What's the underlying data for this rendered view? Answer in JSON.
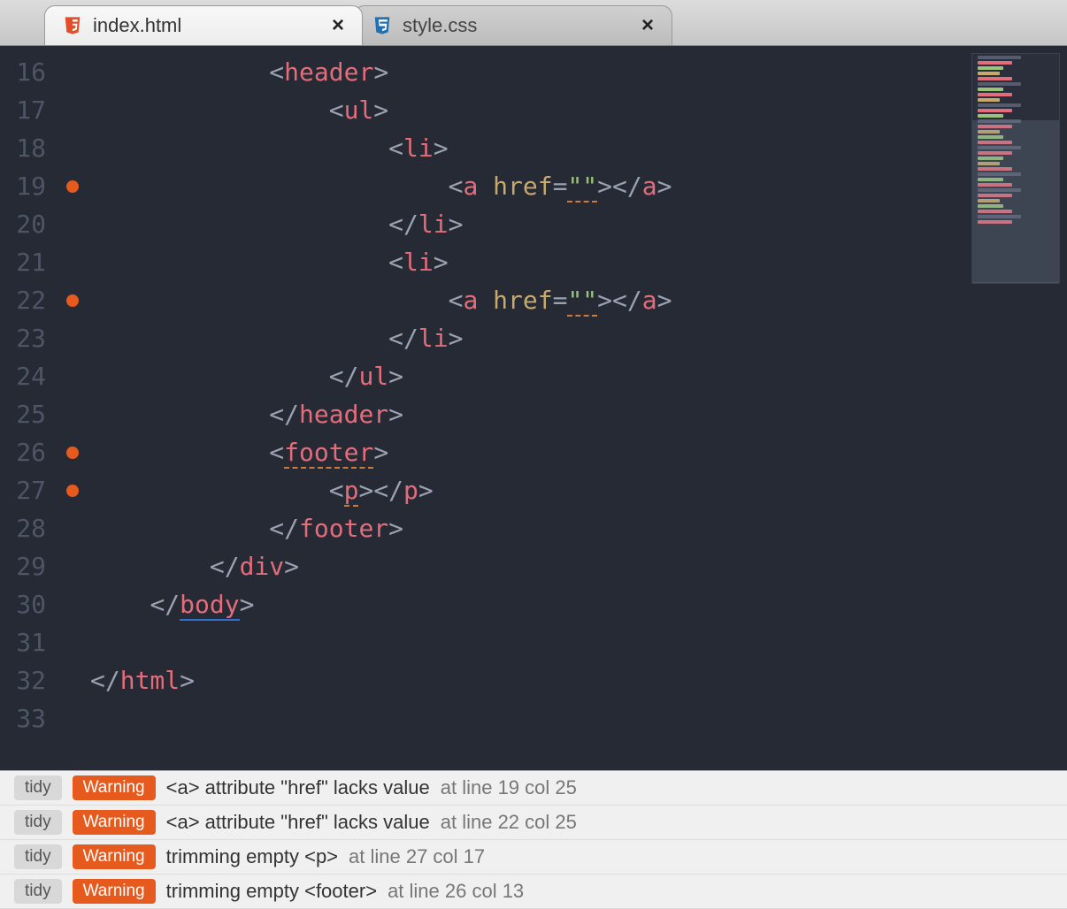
{
  "tabs": [
    {
      "title": "index.html",
      "icon": "html5",
      "active": true
    },
    {
      "title": "style.css",
      "icon": "css3",
      "active": false
    }
  ],
  "editor": {
    "first_line": 16,
    "last_line": 33,
    "error_marker_lines": [
      19,
      22,
      26,
      27
    ],
    "lines": {
      "16": {
        "indent": 12,
        "tokens": [
          [
            "br",
            "<"
          ],
          [
            "tg",
            "header"
          ],
          [
            "br",
            ">"
          ]
        ]
      },
      "17": {
        "indent": 16,
        "tokens": [
          [
            "br",
            "<"
          ],
          [
            "tg",
            "ul"
          ],
          [
            "br",
            ">"
          ]
        ]
      },
      "18": {
        "indent": 20,
        "tokens": [
          [
            "br",
            "<"
          ],
          [
            "tg",
            "li"
          ],
          [
            "br",
            ">"
          ]
        ]
      },
      "19": {
        "indent": 24,
        "tokens": [
          [
            "br",
            "<"
          ],
          [
            "tg",
            "a"
          ],
          [
            "br",
            " "
          ],
          [
            "at",
            "href"
          ],
          [
            "br",
            "="
          ],
          [
            "st",
            "\"\"",
            "ul1"
          ],
          [
            "br",
            "></"
          ],
          [
            "tg",
            "a"
          ],
          [
            "br",
            ">"
          ]
        ]
      },
      "20": {
        "indent": 20,
        "tokens": [
          [
            "br",
            "</"
          ],
          [
            "tg",
            "li"
          ],
          [
            "br",
            ">"
          ]
        ]
      },
      "21": {
        "indent": 20,
        "tokens": [
          [
            "br",
            "<"
          ],
          [
            "tg",
            "li"
          ],
          [
            "br",
            ">"
          ]
        ]
      },
      "22": {
        "indent": 24,
        "tokens": [
          [
            "br",
            "<"
          ],
          [
            "tg",
            "a"
          ],
          [
            "br",
            " "
          ],
          [
            "at",
            "href"
          ],
          [
            "br",
            "="
          ],
          [
            "st",
            "\"\"",
            "ul1"
          ],
          [
            "br",
            "></"
          ],
          [
            "tg",
            "a"
          ],
          [
            "br",
            ">"
          ]
        ]
      },
      "23": {
        "indent": 20,
        "tokens": [
          [
            "br",
            "</"
          ],
          [
            "tg",
            "li"
          ],
          [
            "br",
            ">"
          ]
        ]
      },
      "24": {
        "indent": 16,
        "tokens": [
          [
            "br",
            "</"
          ],
          [
            "tg",
            "ul"
          ],
          [
            "br",
            ">"
          ]
        ]
      },
      "25": {
        "indent": 12,
        "tokens": [
          [
            "br",
            "</"
          ],
          [
            "tg",
            "header"
          ],
          [
            "br",
            ">"
          ]
        ]
      },
      "26": {
        "indent": 12,
        "tokens": [
          [
            "br",
            "<"
          ],
          [
            "tg",
            "footer",
            "ul1"
          ],
          [
            "br",
            ">"
          ]
        ]
      },
      "27": {
        "indent": 16,
        "tokens": [
          [
            "br",
            "<"
          ],
          [
            "tg",
            "p",
            "ul1"
          ],
          [
            "br",
            "></"
          ],
          [
            "tg",
            "p"
          ],
          [
            "br",
            ">"
          ]
        ]
      },
      "28": {
        "indent": 12,
        "tokens": [
          [
            "br",
            "</"
          ],
          [
            "tg",
            "footer"
          ],
          [
            "br",
            ">"
          ]
        ]
      },
      "29": {
        "indent": 8,
        "tokens": [
          [
            "br",
            "</"
          ],
          [
            "tg",
            "div"
          ],
          [
            "br",
            ">"
          ]
        ]
      },
      "30": {
        "indent": 4,
        "tokens": [
          [
            "br",
            "</"
          ],
          [
            "tg",
            "body",
            "ul2"
          ],
          [
            "br",
            ">"
          ]
        ]
      },
      "31": {
        "indent": 0,
        "tokens": []
      },
      "32": {
        "indent": 0,
        "tokens": [
          [
            "br",
            "</"
          ],
          [
            "tg",
            "html"
          ],
          [
            "br",
            ">"
          ]
        ]
      },
      "33": {
        "indent": 0,
        "tokens": []
      }
    }
  },
  "lint": {
    "source_label": "tidy",
    "level_label": "Warning",
    "items": [
      {
        "message": "<a> attribute \"href\" lacks value",
        "location": "at line 19 col 25"
      },
      {
        "message": "<a> attribute \"href\" lacks value",
        "location": "at line 22 col 25"
      },
      {
        "message": "trimming empty <p>",
        "location": "at line 27 col 17"
      },
      {
        "message": "trimming empty <footer>",
        "location": "at line 26 col 13"
      }
    ]
  }
}
